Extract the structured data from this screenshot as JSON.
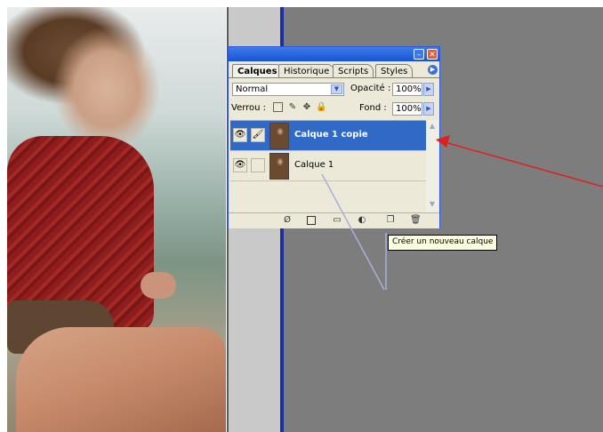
{
  "palette": {
    "tabs": [
      {
        "label": "Calques",
        "active": true
      },
      {
        "label": "Historique",
        "active": false
      },
      {
        "label": "Scripts",
        "active": false
      },
      {
        "label": "Styles",
        "active": false
      }
    ],
    "blend_mode": "Normal",
    "opacity_label": "Opacité :",
    "opacity_value": "100%",
    "lock_label": "Verrou :",
    "fill_label": "Fond :",
    "fill_value": "100%",
    "layers": [
      {
        "name": "Calque 1 copie",
        "selected": true
      },
      {
        "name": "Calque 1",
        "selected": false
      }
    ]
  },
  "tooltip": {
    "text": "Créer un nouveau calque"
  },
  "colors": {
    "selection_blue": "#3169c6",
    "arrow_red": "#e02020",
    "canvas_gray": "#7d7d7d",
    "guide_blue": "#1c2f9e"
  }
}
